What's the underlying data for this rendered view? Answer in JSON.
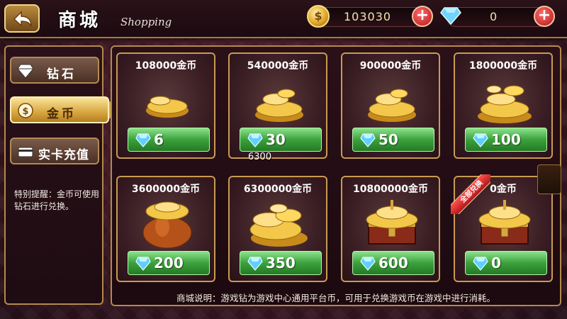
{
  "header": {
    "title_cn": "商城",
    "title_en": "Shopping",
    "coins": "103030",
    "gems": "0"
  },
  "sidebar": {
    "items": [
      {
        "label": "钻石",
        "icon": "diamond-icon"
      },
      {
        "label": "金币",
        "icon": "coin-icon",
        "active": true
      },
      {
        "label": "实卡充值",
        "icon": "card-icon"
      }
    ],
    "note": "特别提醒：金币可使用钻石进行兑换。"
  },
  "products": [
    {
      "amount": "108000金币",
      "price": "6",
      "art": "coins-small"
    },
    {
      "amount": "540000金币",
      "price": "30",
      "art": "coins-medium"
    },
    {
      "amount": "900000金币",
      "price": "50",
      "art": "coins-medium"
    },
    {
      "amount": "1800000金币",
      "price": "100",
      "art": "coins-large"
    },
    {
      "amount": "3600000金币",
      "price": "200",
      "art": "coin-bag"
    },
    {
      "amount": "6300000金币",
      "price": "350",
      "art": "coin-pile"
    },
    {
      "amount": "10800000金币",
      "price": "600",
      "art": "treasure-chest"
    },
    {
      "amount": "0金币",
      "price": "0",
      "art": "treasure-chest",
      "ribbon": "全部兑换"
    }
  ],
  "popup_value": "6300",
  "description": "商城说明：游戏钻为游戏中心通用平台币，可用于兑换游戏币在游戏中进行消耗。",
  "colors": {
    "gold": "#d8a640",
    "green": "#3ca13c",
    "red": "#b11818",
    "background": "#3a1a24"
  }
}
